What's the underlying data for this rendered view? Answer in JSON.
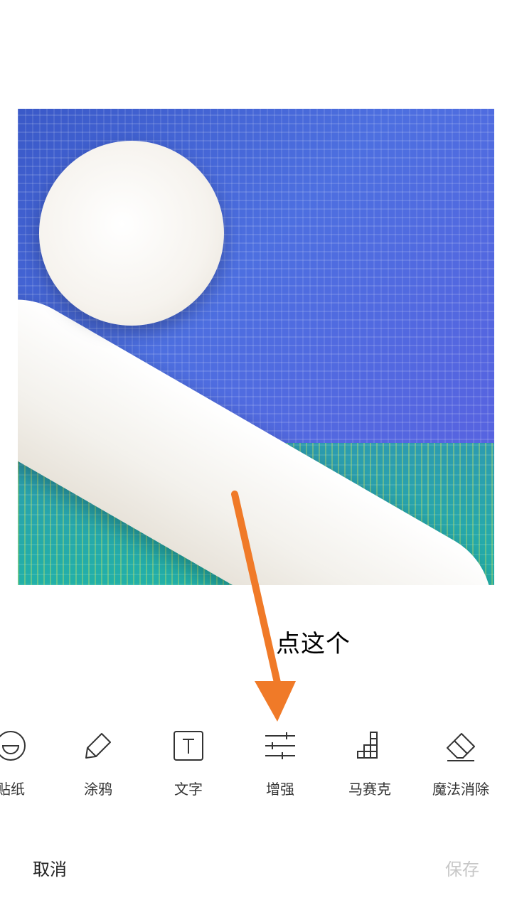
{
  "toolbar": {
    "items": [
      {
        "label": "贴纸",
        "icon": "sticker-icon"
      },
      {
        "label": "涂鸦",
        "icon": "pencil-icon"
      },
      {
        "label": "文字",
        "icon": "text-icon"
      },
      {
        "label": "增强",
        "icon": "sliders-icon"
      },
      {
        "label": "马赛克",
        "icon": "mosaic-icon"
      },
      {
        "label": "魔法消除",
        "icon": "eraser-icon"
      }
    ]
  },
  "annotation": {
    "text": "点这个",
    "color": "#f07a28"
  },
  "footer": {
    "cancel_label": "取消",
    "save_label": "保存"
  }
}
